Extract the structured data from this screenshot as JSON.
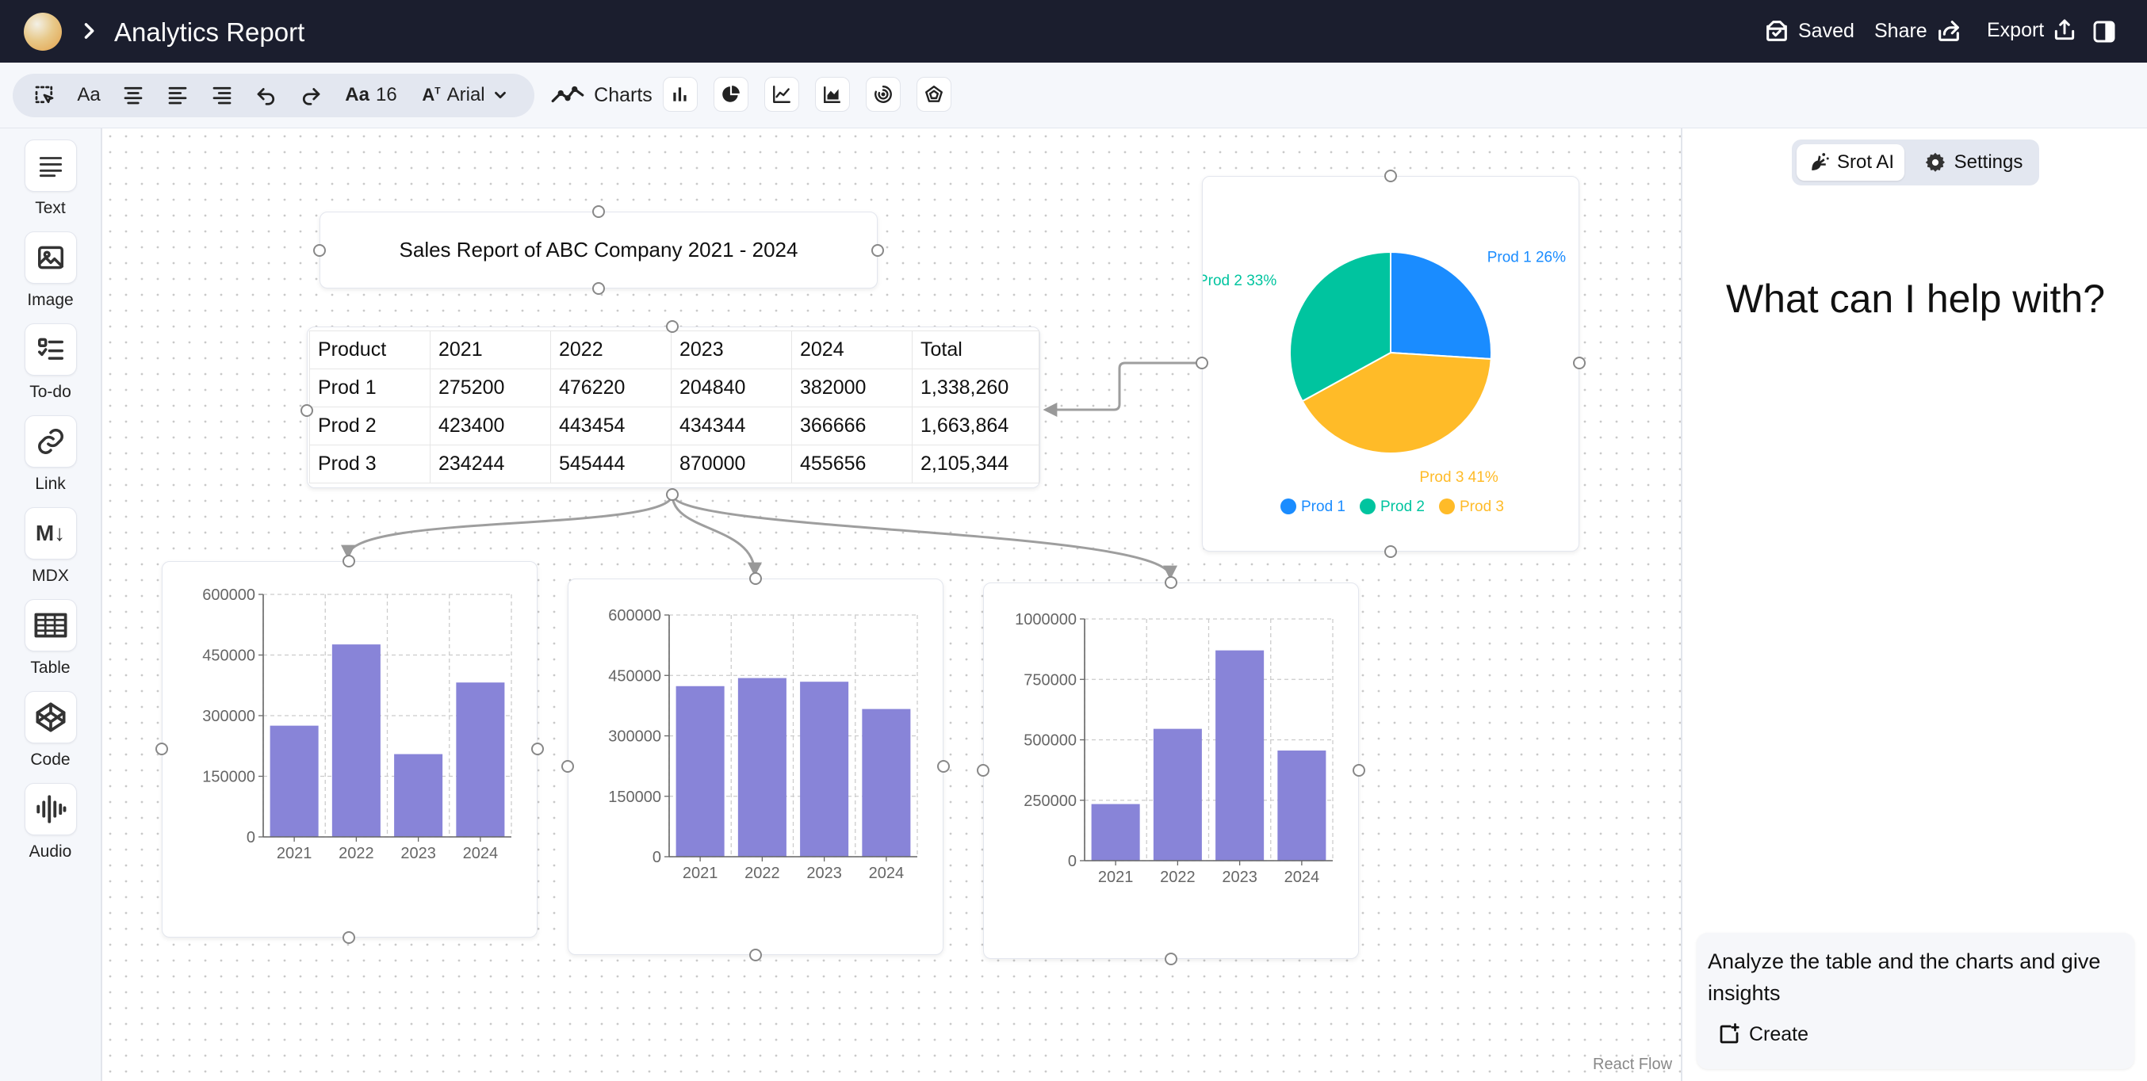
{
  "header": {
    "title": "Analytics Report",
    "saved_label": "Saved",
    "share_label": "Share",
    "export_label": "Export"
  },
  "toolbar": {
    "font_size": "16",
    "font_family": "Arial",
    "charts_label": "Charts"
  },
  "sidebar": {
    "items": [
      {
        "label": "Text",
        "icon": "text-lines-icon"
      },
      {
        "label": "Image",
        "icon": "image-icon"
      },
      {
        "label": "To-do",
        "icon": "todo-list-icon"
      },
      {
        "label": "Link",
        "icon": "link-icon"
      },
      {
        "label": "MDX",
        "icon": "markdown-icon"
      },
      {
        "label": "Table",
        "icon": "table-icon"
      },
      {
        "label": "Code",
        "icon": "codepen-icon"
      },
      {
        "label": "Audio",
        "icon": "audio-wave-icon"
      }
    ]
  },
  "canvas": {
    "title_node": "Sales Report of ABC Company 2021 - 2024",
    "table": {
      "headers": [
        "Product",
        "2021",
        "2022",
        "2023",
        "2024",
        "Total"
      ],
      "rows": [
        [
          "Prod 1",
          "275200",
          "476220",
          "204840",
          "382000",
          "1,338,260"
        ],
        [
          "Prod 2",
          "423400",
          "443454",
          "434344",
          "366666",
          "1,663,864"
        ],
        [
          "Prod 3",
          "234244",
          "545444",
          "870000",
          "455656",
          "2,105,344"
        ]
      ]
    },
    "watermark": "React Flow"
  },
  "chart_data": [
    {
      "type": "pie",
      "categories": [
        "Prod 1",
        "Prod 2",
        "Prod 3"
      ],
      "values": [
        26,
        33,
        41
      ],
      "labels": [
        "Prod 1 26%",
        "Prod 2 33%",
        "Prod 3 41%"
      ],
      "colors": [
        "#1a8cff",
        "#00c49f",
        "#ffbb28"
      ],
      "legend": "bottom"
    },
    {
      "type": "bar",
      "categories": [
        "2021",
        "2022",
        "2023",
        "2024"
      ],
      "values": [
        275200,
        476220,
        204840,
        382000
      ],
      "ylim": [
        0,
        600000
      ],
      "yticks": [
        0,
        150000,
        300000,
        450000,
        600000
      ],
      "color": "#8884d8",
      "grid": true
    },
    {
      "type": "bar",
      "categories": [
        "2021",
        "2022",
        "2023",
        "2024"
      ],
      "values": [
        423400,
        443454,
        434344,
        366666
      ],
      "ylim": [
        0,
        600000
      ],
      "yticks": [
        0,
        150000,
        300000,
        450000,
        600000
      ],
      "color": "#8884d8",
      "grid": true
    },
    {
      "type": "bar",
      "categories": [
        "2021",
        "2022",
        "2023",
        "2024"
      ],
      "values": [
        234244,
        545444,
        870000,
        455656
      ],
      "ylim": [
        0,
        1000000
      ],
      "yticks": [
        0,
        250000,
        500000,
        750000,
        1000000
      ],
      "color": "#8884d8",
      "grid": true
    }
  ],
  "assistant": {
    "tabs": [
      "Srot AI",
      "Settings"
    ],
    "heading": "What can I help with?",
    "prompt_text": "Analyze the table and the charts and give insights",
    "create_label": "Create"
  }
}
